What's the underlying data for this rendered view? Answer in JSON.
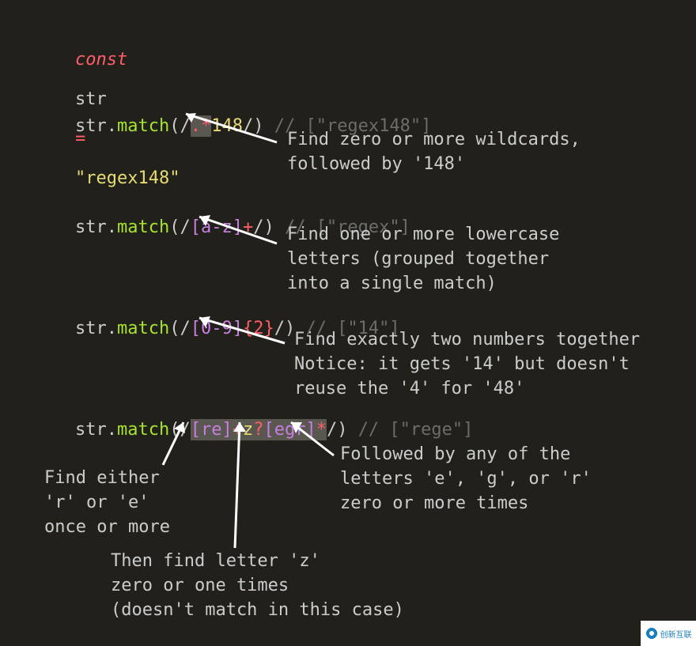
{
  "decl": {
    "const": "const",
    "varname": "str",
    "eq": "=",
    "value": "\"regex148\""
  },
  "line1": {
    "str": "str",
    "dot": ".",
    "method": "match",
    "lparen": "(",
    "slash1": "/",
    "dotstar": ".*",
    "lit": "148",
    "slash2": "/",
    "rparen": ")",
    "comment": "// [\"regex148\"]"
  },
  "anno1": "Find zero or more wildcards,\nfollowed by '148'",
  "line2": {
    "str": "str",
    "dot": ".",
    "method": "match",
    "lparen": "(",
    "slash1": "/",
    "class": "[a-z]",
    "quant": "+",
    "slash2": "/",
    "rparen": ")",
    "comment": "// [\"regex\"]"
  },
  "anno2": "Find one or more lowercase\nletters (grouped together\ninto a single match)",
  "line3": {
    "str": "str",
    "dot": ".",
    "method": "match",
    "lparen": "(",
    "slash1": "/",
    "class": "[0-9]",
    "quant": "{2}",
    "slash2": "/",
    "rparen": ")",
    "comment": "// [\"14\"]"
  },
  "anno3": "Find exactly two numbers together\nNotice: it gets '14' but doesn't\nreuse the '4' for '48'",
  "line4": {
    "str": "str",
    "dot": ".",
    "method": "match",
    "lparen": "(",
    "slash1": "/",
    "class1": "[re]",
    "quant1": "+",
    "z": "z",
    "quant2": "?",
    "class2": "[egr]",
    "quant3": "*",
    "slash2": "/",
    "rparen": ")",
    "comment": "// [\"rege\"]"
  },
  "anno4a": "Find either\n'r' or 'e'\nonce or more",
  "anno4b": "Then find letter 'z'\nzero or one times\n(doesn't match in this case)",
  "anno4c": "Followed by any of the\nletters 'e', 'g', or 'r'\nzero or more times",
  "watermark": "创新互联"
}
